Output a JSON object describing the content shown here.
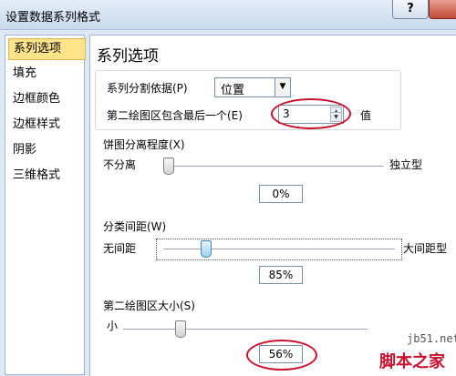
{
  "window": {
    "title": "设置数据系列格式",
    "help_label": "?"
  },
  "sidebar": {
    "items": [
      {
        "label": "系列选项",
        "active": true
      },
      {
        "label": "填充"
      },
      {
        "label": "边框颜色"
      },
      {
        "label": "边框样式"
      },
      {
        "label": "阴影"
      },
      {
        "label": "三维格式"
      }
    ]
  },
  "panel": {
    "title": "系列选项",
    "split": {
      "label": "系列分割依据(P)",
      "value": "位置"
    },
    "second_plot_contains": {
      "label": "第二绘图区包含最后一个(E)",
      "value": "3",
      "unit": "值"
    },
    "pie_explosion": {
      "label": "饼图分离程度(X)",
      "min_label": "不分离",
      "max_label": "独立型",
      "value": "0%",
      "fraction": 0.0
    },
    "gap_width": {
      "label": "分类间距(W)",
      "min_label": "无间距",
      "max_label": "大间距型",
      "value": "85%",
      "fraction": 0.17
    },
    "second_plot_size": {
      "label": "第二绘图区大小(S)",
      "min_label": "小",
      "value": "56%",
      "fraction": 0.22
    }
  },
  "colors": {
    "highlight": "#c8102e",
    "active_item": "#fde38a"
  },
  "watermark": {
    "url": "jb51.net",
    "name": "脚本之家"
  }
}
